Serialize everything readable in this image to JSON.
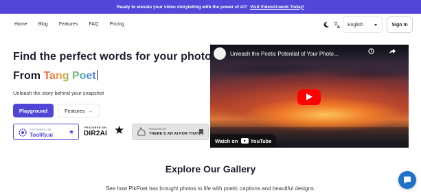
{
  "banner": {
    "text": "Ready to elevate your video storytelling with the power of AI?",
    "link": "Visit VideoAI.work Today!"
  },
  "nav": {
    "links": [
      "Home",
      "Blog",
      "Features",
      "FAQ",
      "Pricing"
    ],
    "language": "English",
    "signin": "Sign In"
  },
  "hero": {
    "title_line1": "Find the perfect words for your photos",
    "title_from": "From ",
    "title_brand": "Tang Poet",
    "subtitle": "Unleash the story behind your snapshot",
    "playground_btn": "Playground",
    "features_btn": "Features",
    "features_arrow": "→"
  },
  "badges": {
    "toolify_small": "FEATURED ON",
    "toolify_big": "Toolify.ai",
    "toolify_star": "★",
    "dir2ai_small": "FEATURED ON",
    "dir2ai_big": "DIR2AI",
    "dir2ai_star": "★",
    "taaft_small": "FEATURED ON",
    "taaft_big": "THERE'S AN AI FOR THAT"
  },
  "video": {
    "title": "Unleash the Poetic Potential of Your Photo...",
    "watch_label": "Watch on",
    "youtube_label": "YouTube"
  },
  "gallery": {
    "title": "Explore Our Gallery",
    "subtitle": "See how PikPoet has brought photos to life with poetic captions and beautiful designs."
  },
  "colors": {
    "accent": "#5146d9",
    "play_red": "#ff0000",
    "chat_blue": "#1e73c8"
  }
}
